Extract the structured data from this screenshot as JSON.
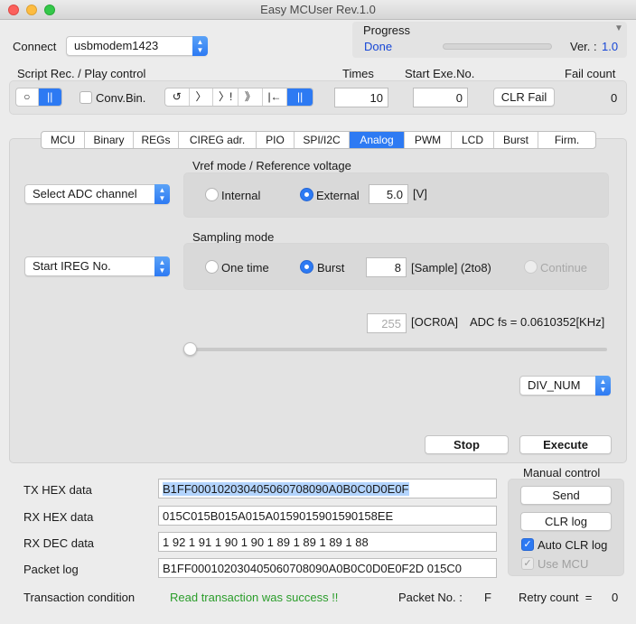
{
  "window": {
    "title": "Easy MCUser Rev.1.0"
  },
  "connect": {
    "label": "Connect",
    "port": "usbmodem1423"
  },
  "progress": {
    "label": "Progress",
    "status": "Done",
    "value": 0
  },
  "version": {
    "label": "Ver. :",
    "value": "1.0"
  },
  "script": {
    "label": "Script Rec. / Play control",
    "rec_symbol": "○",
    "pause_symbol": "||",
    "conv_bin": "Conv.Bin.",
    "play_controls": [
      "↺",
      "〉",
      "〉!",
      "》",
      "|←",
      "||"
    ]
  },
  "times": {
    "label": "Times",
    "value": "10"
  },
  "start_exe": {
    "label": "Start Exe.No.",
    "value": "0"
  },
  "clr_fail": {
    "label": "CLR Fail"
  },
  "fail_count": {
    "label": "Fail count",
    "value": "0"
  },
  "tabs": [
    "MCU",
    "Binary",
    "REGs",
    "CIREG adr.",
    "PIO",
    "SPI/I2C",
    "Analog",
    "PWM",
    "LCD",
    "Burst",
    "Firm."
  ],
  "active_tab": "Analog",
  "analog": {
    "adc_select": "Select ADC channel",
    "vref": {
      "title": "Vref mode / Reference voltage",
      "internal": "Internal",
      "external": "External",
      "selected": "External",
      "value": "5.0",
      "unit": "[V]"
    },
    "ireg_select": "Start IREG No.",
    "sampling": {
      "title": "Sampling mode",
      "one_time": "One time",
      "burst": "Burst",
      "selected": "Burst",
      "samples": "8",
      "samples_unit": "[Sample] (2to8)",
      "continue": "Continue"
    },
    "ocr": {
      "value": "255",
      "label": "[OCR0A]",
      "adc_fs": "ADC fs = 0.0610352[KHz]",
      "slider_value": 0
    },
    "div_select": "DIV_NUM",
    "stop": "Stop",
    "execute": "Execute"
  },
  "data": {
    "tx_hex_label": "TX HEX data",
    "tx_hex": "B1FF000102030405060708090A0B0C0D0E0F",
    "rx_hex_label": "RX HEX data",
    "rx_hex": "015C015B015A015A0159015901590158EE",
    "rx_dec_label": "RX DEC data",
    "rx_dec": "1 92 1 91 1 90 1 90 1 89 1 89 1 89 1 88",
    "packet_log_label": "Packet log",
    "packet_log": "B1FF000102030405060708090A0B0C0D0E0F2D 015C0"
  },
  "manual": {
    "title": "Manual control",
    "send": "Send",
    "clr_log": "CLR log",
    "auto_clr": "Auto CLR log",
    "use_mcu": "Use MCU"
  },
  "status": {
    "transaction_label": "Transaction condition",
    "transaction_msg": "Read transaction was success !!",
    "packet_no_label": "Packet No. :",
    "packet_no": "F",
    "retry_label": "Retry count  =",
    "retry": "0"
  },
  "colors": {
    "accent": "#2d7af3",
    "success": "#2a9d2a",
    "link": "#1747d6"
  }
}
